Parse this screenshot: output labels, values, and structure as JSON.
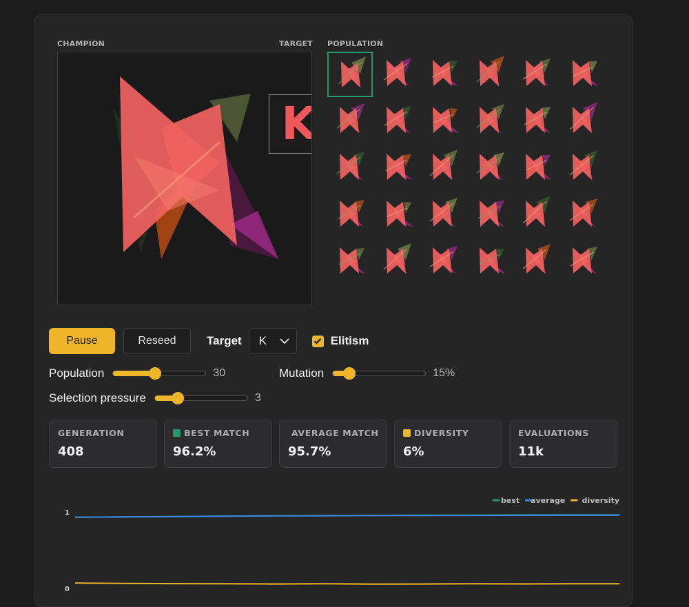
{
  "canvas": {
    "champion_label": "CHAMPION",
    "target_label": "TARGET",
    "population_label": "POPULATION",
    "target_letter": "K",
    "target_color": "#f0585b",
    "selected_index": 0,
    "population_size": 30
  },
  "controls": {
    "pause_label": "Pause",
    "reseed_label": "Reseed",
    "target_label": "Target",
    "target_value": "K",
    "elitism_label": "Elitism",
    "elitism_checked": true,
    "population_label": "Population",
    "population_value": "30",
    "population_fraction": 0.45,
    "mutation_label": "Mutation",
    "mutation_value": "15%",
    "mutation_fraction": 0.18,
    "selection_label": "Selection pressure",
    "selection_value": "3",
    "selection_fraction": 0.25,
    "accent_color": "#f0b62a"
  },
  "stats": [
    {
      "label": "GENERATION",
      "value": "408",
      "swatch": ""
    },
    {
      "label": "BEST MATCH",
      "value": "96.2%",
      "swatch": "#1f9a69"
    },
    {
      "label": "AVERAGE MATCH",
      "value": "95.7%",
      "swatch": "#3d86e8"
    },
    {
      "label": "DIVERSITY",
      "value": "6%",
      "swatch": "#f0b62a"
    },
    {
      "label": "EVALUATIONS",
      "value": "11k",
      "swatch": ""
    }
  ],
  "chart_data": {
    "type": "line",
    "ylim": [
      0,
      1
    ],
    "y_ticks": [
      "0",
      "1"
    ],
    "legend_position": "top-right",
    "legend": [
      "best",
      "average",
      "diversity"
    ],
    "series": [
      {
        "name": "best",
        "color": "#1f9a69",
        "values": [
          0.93,
          0.935,
          0.94,
          0.945,
          0.95,
          0.952,
          0.955,
          0.957,
          0.958,
          0.96,
          0.961,
          0.962
        ]
      },
      {
        "name": "average",
        "color": "#3d86e8",
        "values": [
          0.93,
          0.935,
          0.94,
          0.944,
          0.948,
          0.95,
          0.952,
          0.953,
          0.954,
          0.955,
          0.956,
          0.957
        ]
      },
      {
        "name": "diversity",
        "color": "#f0b62a",
        "values": [
          0.07,
          0.065,
          0.062,
          0.06,
          0.058,
          0.06,
          0.057,
          0.058,
          0.06,
          0.059,
          0.061,
          0.06
        ]
      }
    ]
  }
}
